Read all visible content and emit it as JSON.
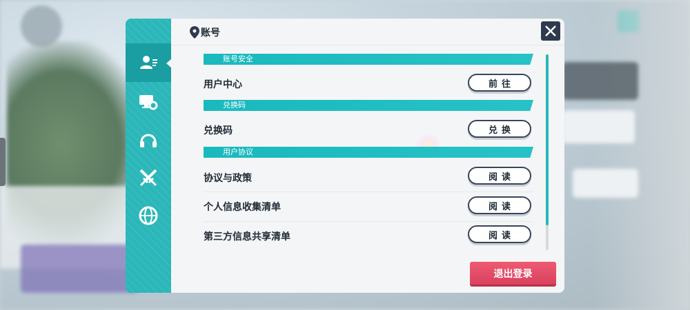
{
  "header": {
    "title": "账号"
  },
  "sidebar": {
    "items": [
      {
        "icon": "account-icon",
        "active": true
      },
      {
        "icon": "display-settings-icon",
        "active": false
      },
      {
        "icon": "headphones-icon",
        "active": false
      },
      {
        "icon": "crossed-swords-icon",
        "active": false
      },
      {
        "icon": "globe-icon",
        "active": false
      }
    ]
  },
  "sections": [
    {
      "title": "账号安全",
      "rows": [
        {
          "label": "用户中心",
          "button": "前往"
        }
      ]
    },
    {
      "title": "兑换码",
      "rows": [
        {
          "label": "兑换码",
          "button": "兑换"
        }
      ]
    },
    {
      "title": "用户协议",
      "rows": [
        {
          "label": "协议与政策",
          "button": "阅读"
        },
        {
          "label": "个人信息收集清单",
          "button": "阅读"
        },
        {
          "label": "第三方信息共享清单",
          "button": "阅读"
        }
      ]
    }
  ],
  "footer": {
    "logout_label": "退出登录"
  },
  "colors": {
    "accent": "#2bb7b9",
    "danger": "#e04c66",
    "dark": "#2e3a4e"
  }
}
